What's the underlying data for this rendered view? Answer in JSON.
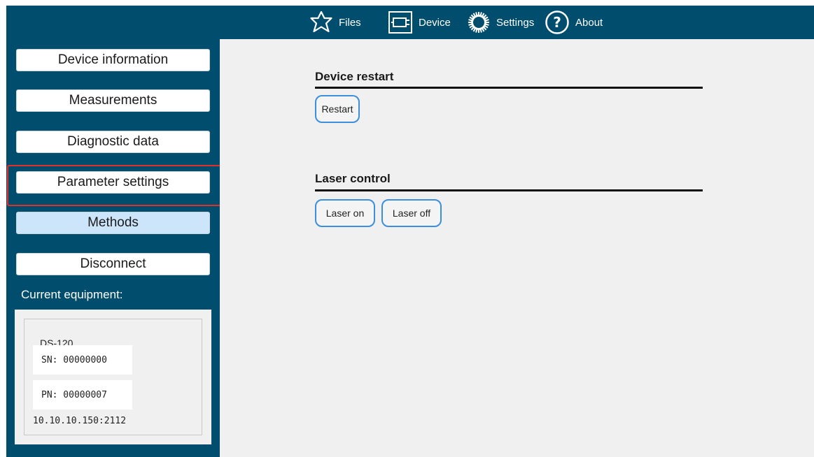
{
  "topbar": {
    "items": [
      {
        "label": "Files",
        "icon": "star-icon"
      },
      {
        "label": "Device",
        "icon": "device-icon"
      },
      {
        "label": "Settings",
        "icon": "gear-icon"
      },
      {
        "label": "About",
        "icon": "question-icon"
      }
    ]
  },
  "sidebar": {
    "items": [
      {
        "label": "Device information"
      },
      {
        "label": "Measurements"
      },
      {
        "label": "Diagnostic data"
      },
      {
        "label": "Parameter settings"
      },
      {
        "label": "Methods",
        "active": true
      },
      {
        "label": "Disconnect"
      }
    ],
    "equipment_label": "Current equipment:",
    "equipment": {
      "model": "DS-120",
      "sn": "SN: 00000000",
      "pn": "PN: 00000007",
      "address": "10.10.10.150:2112"
    }
  },
  "main": {
    "restart_section": {
      "title": "Device restart",
      "button": "Restart"
    },
    "laser_section": {
      "title": "Laser control",
      "buttons": [
        "Laser on",
        "Laser off"
      ]
    }
  },
  "colors": {
    "chrome": "#004d6e",
    "content_bg": "#f0f0f0",
    "active_item": "#cce5fb",
    "button_border": "#3d8fdc",
    "highlight": "#e0302a"
  }
}
